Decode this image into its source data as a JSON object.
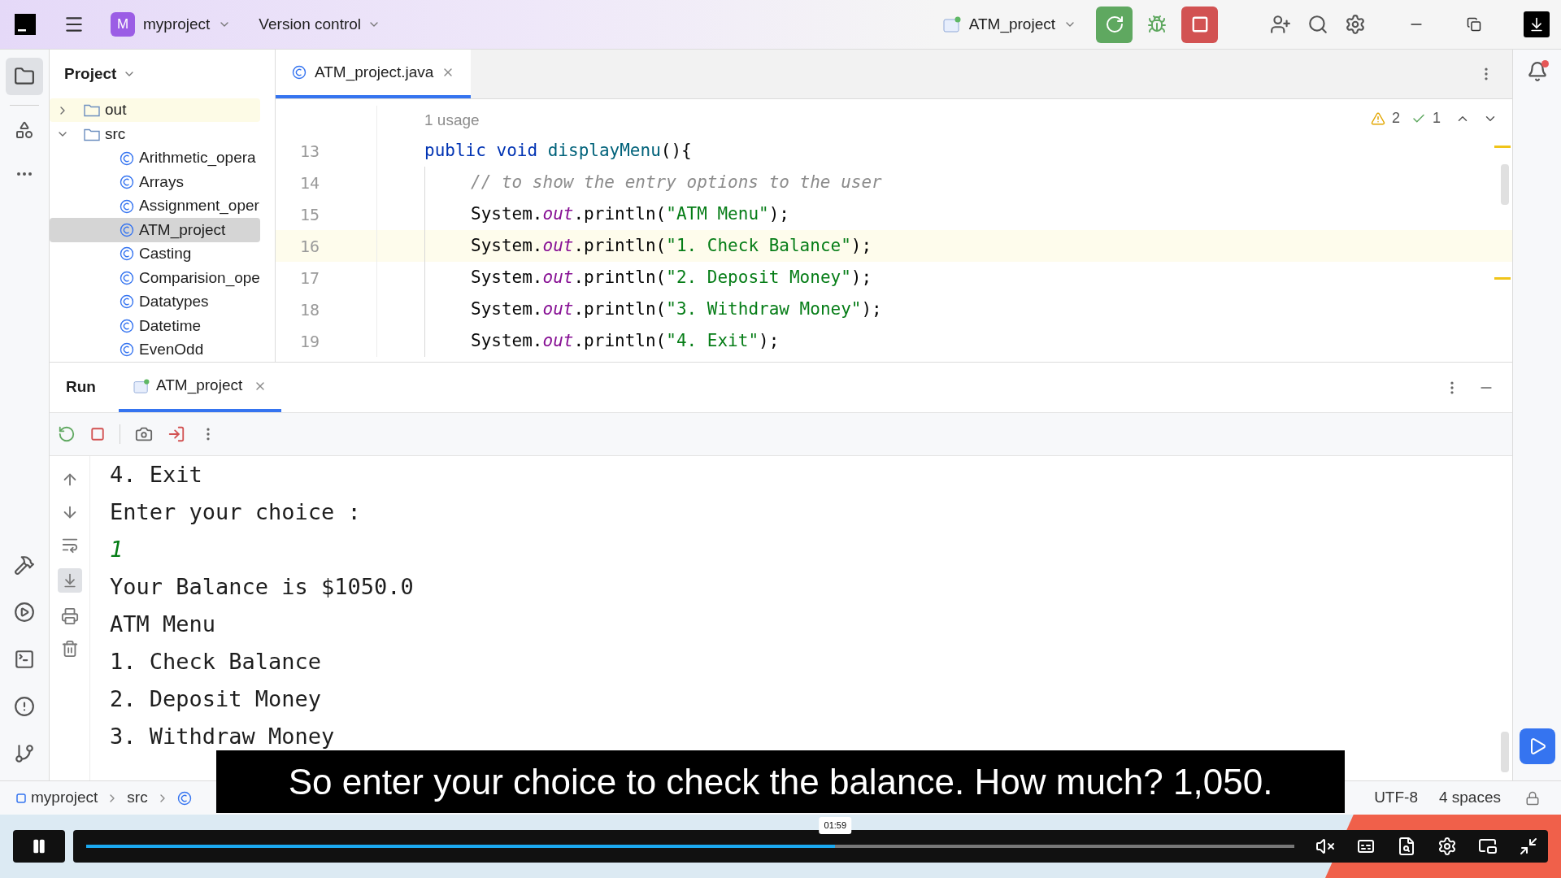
{
  "title_bar": {
    "project_badge": "M",
    "project": "myproject",
    "vcs": "Version control",
    "run_config": "ATM_project"
  },
  "project_panel": {
    "title": "Project",
    "tree": [
      {
        "name": "out",
        "kind": "folder",
        "expanded": false,
        "selected": false
      },
      {
        "name": "src",
        "kind": "folder",
        "expanded": true,
        "selected": false,
        "children": [
          {
            "name": "Arithmetic_opera",
            "kind": "class",
            "selected": false
          },
          {
            "name": "Arrays",
            "kind": "class",
            "selected": false
          },
          {
            "name": "Assignment_oper",
            "kind": "class",
            "selected": false
          },
          {
            "name": "ATM_project",
            "kind": "class",
            "selected": true
          },
          {
            "name": "Casting",
            "kind": "class",
            "selected": false
          },
          {
            "name": "Comparision_ope",
            "kind": "class",
            "selected": false
          },
          {
            "name": "Datatypes",
            "kind": "class",
            "selected": false
          },
          {
            "name": "Datetime",
            "kind": "class",
            "selected": false
          },
          {
            "name": "EvenOdd",
            "kind": "class",
            "selected": false
          }
        ]
      }
    ]
  },
  "editor": {
    "tabs": [
      {
        "label": "ATM_project.java",
        "selected": true
      }
    ],
    "usage_hint": "1 usage",
    "warnings": "2",
    "checks": "1",
    "lines": [
      {
        "number": "13",
        "indented": false,
        "current": false,
        "tokens": [
          {
            "kind": "keyword",
            "text": "public void "
          },
          {
            "kind": "method",
            "text": "displayMenu"
          },
          {
            "kind": "plain",
            "text": "(){"
          }
        ]
      },
      {
        "number": "14",
        "indented": true,
        "current": false,
        "tokens": [
          {
            "kind": "comment",
            "text": "// to show the entry options to the user"
          }
        ]
      },
      {
        "number": "15",
        "indented": true,
        "current": false,
        "tokens": [
          {
            "kind": "plain",
            "text": "System."
          },
          {
            "kind": "field",
            "text": "out"
          },
          {
            "kind": "plain",
            "text": ".println("
          },
          {
            "kind": "string",
            "text": "\"ATM Menu\""
          },
          {
            "kind": "plain",
            "text": ");"
          }
        ]
      },
      {
        "number": "16",
        "indented": true,
        "current": true,
        "tokens": [
          {
            "kind": "plain",
            "text": "System."
          },
          {
            "kind": "field",
            "text": "out"
          },
          {
            "kind": "plain",
            "text": ".println("
          },
          {
            "kind": "string",
            "text": "\"1. Check Balance\""
          },
          {
            "kind": "plain",
            "text": ");"
          }
        ]
      },
      {
        "number": "17",
        "indented": true,
        "current": false,
        "tokens": [
          {
            "kind": "plain",
            "text": "System."
          },
          {
            "kind": "field",
            "text": "out"
          },
          {
            "kind": "plain",
            "text": ".println("
          },
          {
            "kind": "string",
            "text": "\"2. Deposit Money\""
          },
          {
            "kind": "plain",
            "text": ");"
          }
        ]
      },
      {
        "number": "18",
        "indented": true,
        "current": false,
        "tokens": [
          {
            "kind": "plain",
            "text": "System."
          },
          {
            "kind": "field",
            "text": "out"
          },
          {
            "kind": "plain",
            "text": ".println("
          },
          {
            "kind": "string",
            "text": "\"3. Withdraw Money\""
          },
          {
            "kind": "plain",
            "text": ");"
          }
        ]
      },
      {
        "number": "19",
        "indented": true,
        "current": false,
        "tokens": [
          {
            "kind": "plain",
            "text": "System."
          },
          {
            "kind": "field",
            "text": "out"
          },
          {
            "kind": "plain",
            "text": ".println("
          },
          {
            "kind": "string",
            "text": "\"4. Exit\""
          },
          {
            "kind": "plain",
            "text": ");"
          }
        ]
      }
    ]
  },
  "run_panel": {
    "title": "Run",
    "tabs": [
      {
        "label": "ATM_project",
        "selected": true
      }
    ],
    "console": [
      {
        "kind": "output",
        "text": "4. Exit"
      },
      {
        "kind": "output",
        "text": "Enter your choice :"
      },
      {
        "kind": "input",
        "text": "1"
      },
      {
        "kind": "output",
        "text": "Your Balance is $1050.0"
      },
      {
        "kind": "output",
        "text": "ATM Menu"
      },
      {
        "kind": "output",
        "text": "1. Check Balance"
      },
      {
        "kind": "output",
        "text": "2. Deposit Money"
      },
      {
        "kind": "output",
        "text": "3. Withdraw Money"
      }
    ]
  },
  "status_bar": {
    "breadcrumbs": [
      "myproject",
      "src"
    ],
    "encoding": "UTF-8",
    "indent": "4 spaces"
  },
  "video_player": {
    "caption": "So enter your choice to check the balance. How much? 1,050.",
    "time": "01:59",
    "playing": true,
    "level": 0.62
  }
}
